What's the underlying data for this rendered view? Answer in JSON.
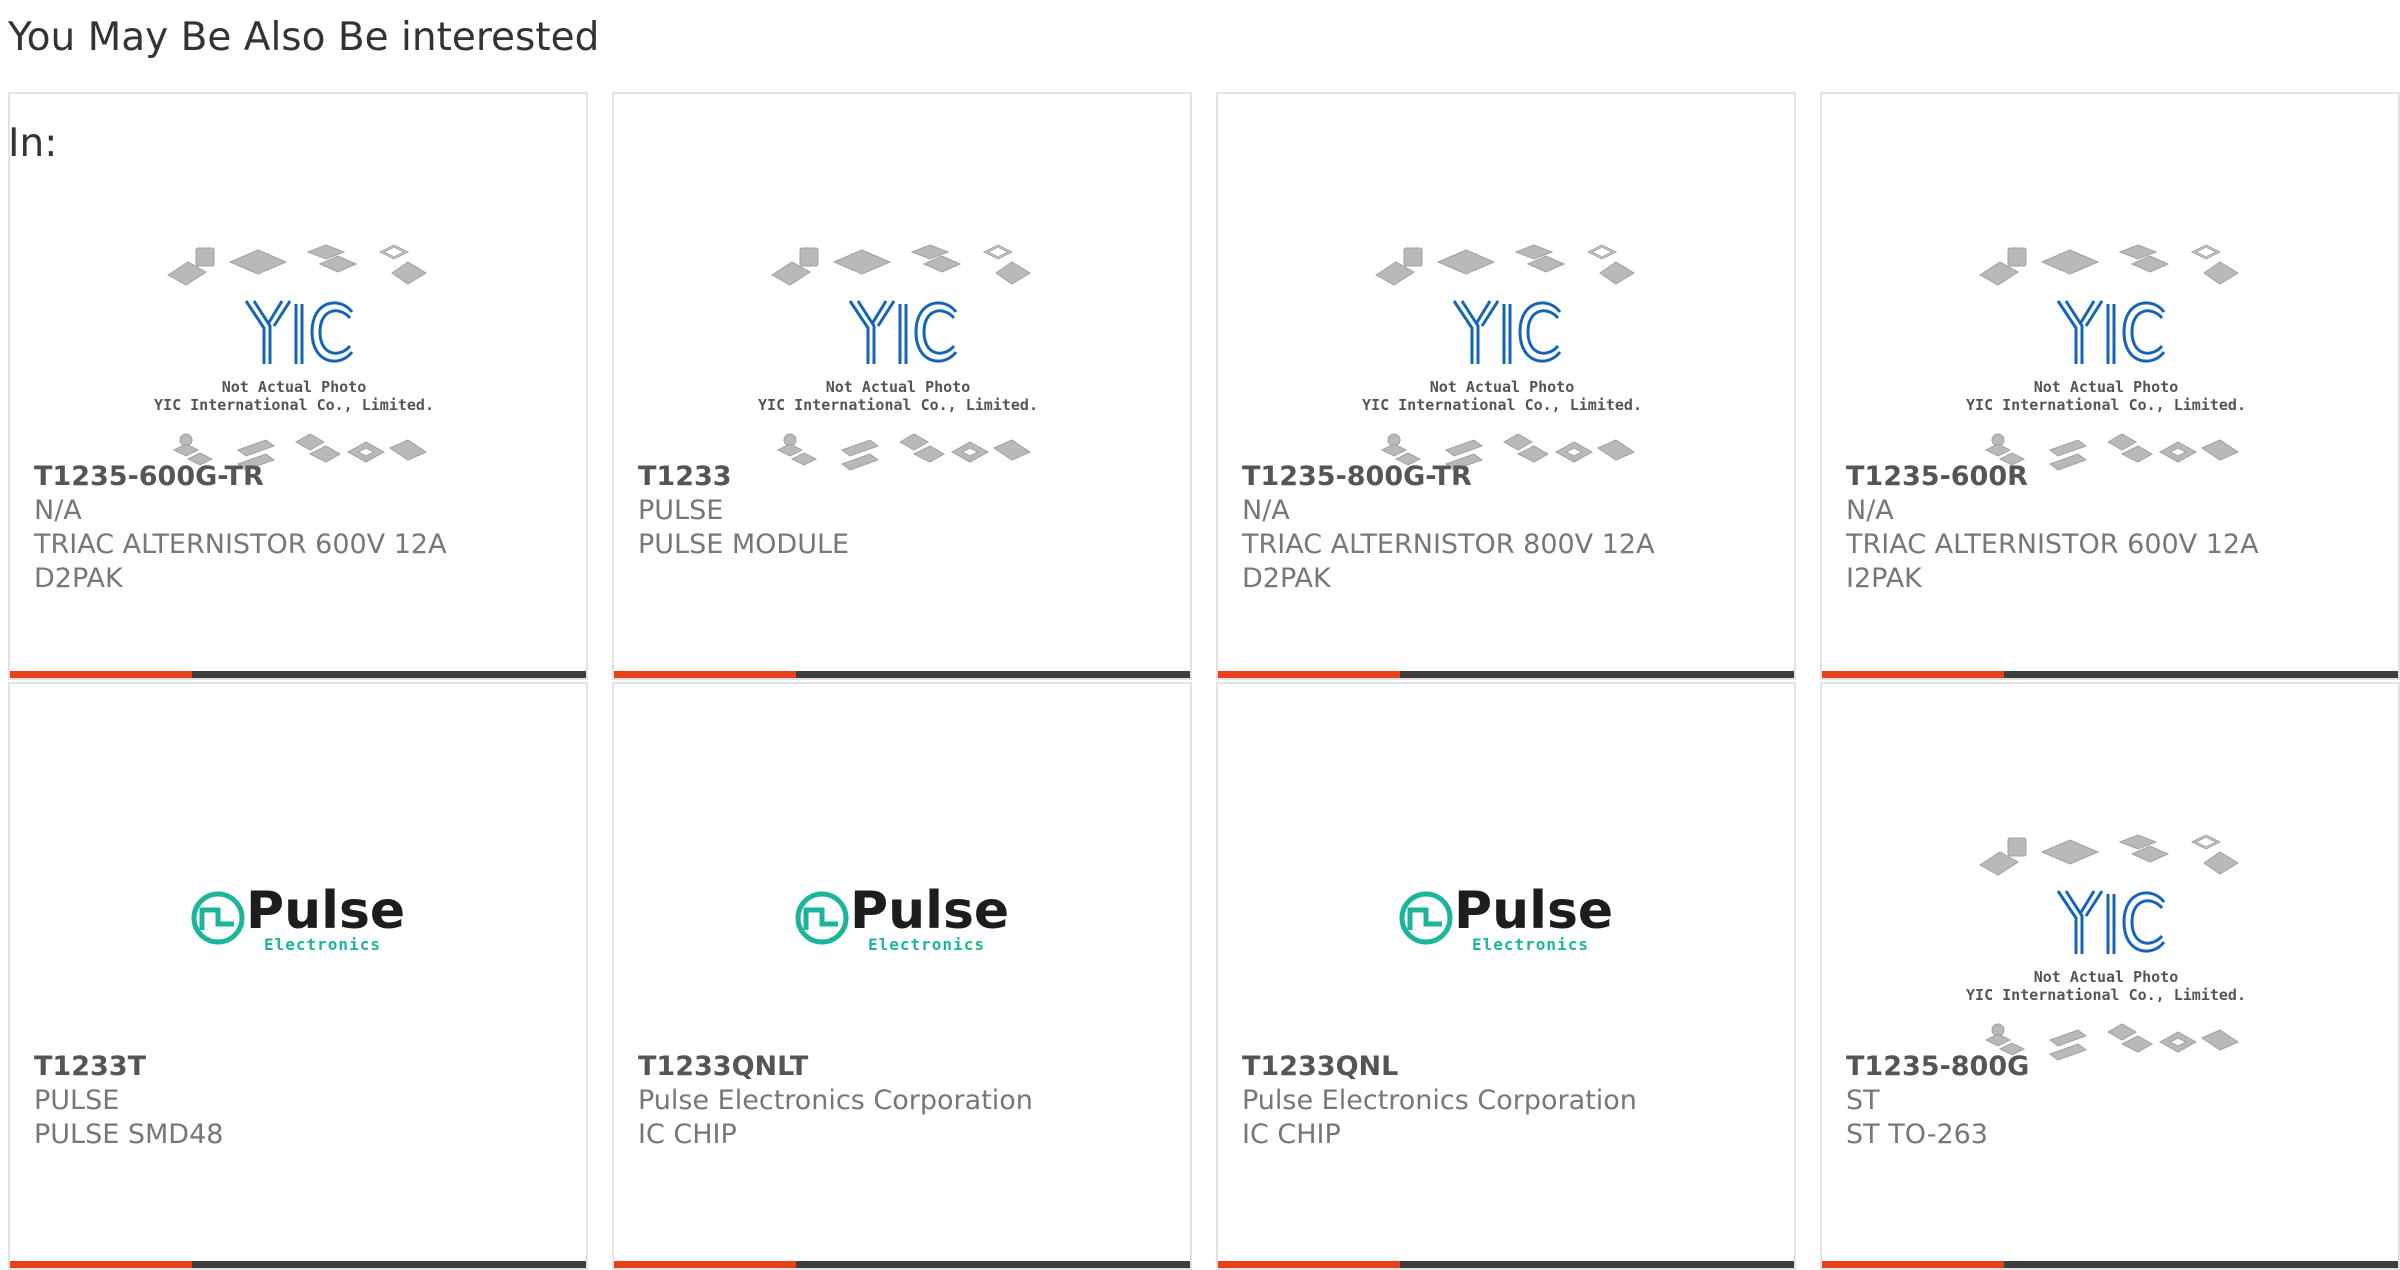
{
  "section_title": "You May Be Also Be interested",
  "section_title_suffix": "In:",
  "colors": {
    "accent": "#e8411a",
    "bar": "#3d3d3d",
    "pulse_brand": "#1bb69a",
    "yic_blue": "#1565b4"
  },
  "placeholder_image": {
    "line1": "Not Actual Photo",
    "line2": "YIC International Co., Limited."
  },
  "pulse_logo": {
    "word": "Pulse",
    "sub": "Electronics"
  },
  "products": [
    {
      "part": "T1235-600G-TR",
      "maker": "N/A",
      "desc1": "TRIAC ALTERNISTOR 600V 12A",
      "desc2": "D2PAK",
      "image": "yic-placeholder"
    },
    {
      "part": "T1233",
      "maker": "PULSE",
      "desc1": "PULSE MODULE",
      "desc2": "",
      "image": "yic-placeholder"
    },
    {
      "part": "T1235-800G-TR",
      "maker": "N/A",
      "desc1": "TRIAC ALTERNISTOR 800V 12A",
      "desc2": "D2PAK",
      "image": "yic-placeholder"
    },
    {
      "part": "T1235-600R",
      "maker": "N/A",
      "desc1": "TRIAC ALTERNISTOR 600V 12A",
      "desc2": "I2PAK",
      "image": "yic-placeholder"
    },
    {
      "part": "T1233T",
      "maker": "PULSE",
      "desc1": "PULSE SMD48",
      "desc2": "",
      "image": "pulse-logo"
    },
    {
      "part": "T1233QNLT",
      "maker": "Pulse Electronics Corporation",
      "desc1": "IC CHIP",
      "desc2": "",
      "image": "pulse-logo"
    },
    {
      "part": "T1233QNL",
      "maker": "Pulse Electronics Corporation",
      "desc1": "IC CHIP",
      "desc2": "",
      "image": "pulse-logo"
    },
    {
      "part": "T1235-800G",
      "maker": "ST",
      "desc1": "ST TO-263",
      "desc2": "",
      "image": "yic-placeholder"
    }
  ]
}
